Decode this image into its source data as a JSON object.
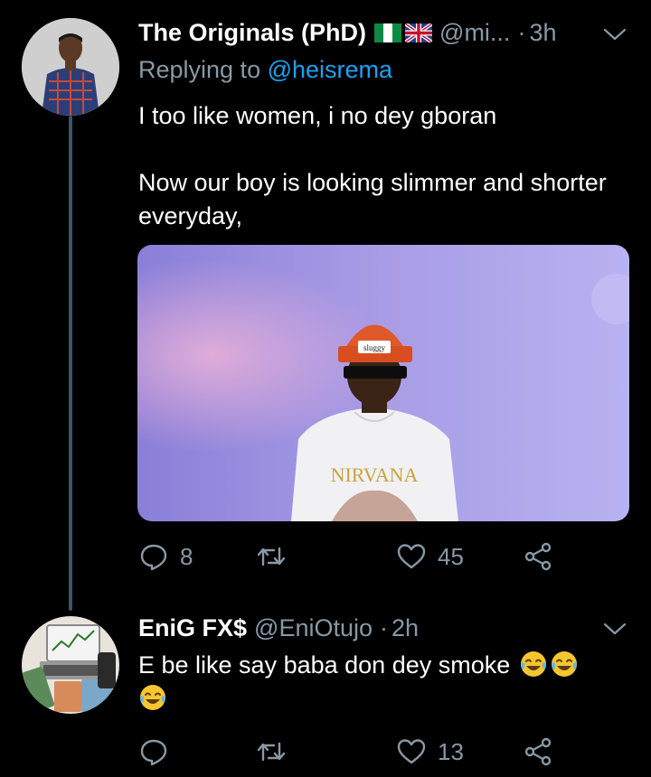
{
  "tweet1": {
    "display_name": "The Originals (PhD)",
    "flags": [
      "nigeria-flag",
      "uk-flag"
    ],
    "handle": "@mi...",
    "dot": "·",
    "time": "3h",
    "reply_prefix": "Replying to ",
    "reply_to": "@heisrema",
    "line1": "I too like women, i no dey gboran",
    "line2": "Now our boy is looking  slimmer and shorter  everyday,",
    "media_caption_text": "NIRVANA",
    "media_hat_label": "sluggy",
    "reply_count": "8",
    "retweet_count": "",
    "like_count": "45"
  },
  "tweet2": {
    "display_name": "EniG FX$",
    "handle": "@EniOtujo",
    "dot": "·",
    "time": "2h",
    "text": "E be like say baba don dey smoke",
    "emoji": "face-with-tears-of-joy",
    "reply_count": "",
    "retweet_count": "",
    "like_count": "13"
  },
  "colors": {
    "background": "#000000",
    "secondary_text": "#8899a6",
    "link": "#1da1f2",
    "thread_line": "#3d5466"
  },
  "icons": [
    "reply-icon",
    "retweet-icon",
    "like-icon",
    "share-icon",
    "chevron-down-icon"
  ]
}
